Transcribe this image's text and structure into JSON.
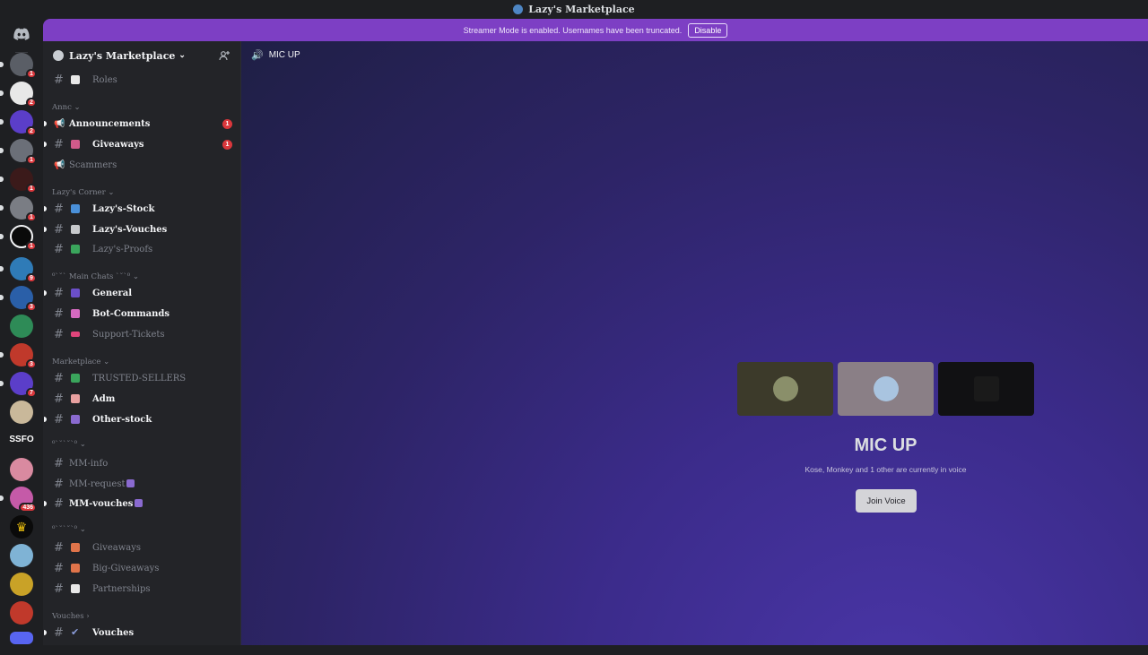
{
  "window": {
    "title": "Lazy's Marketplace"
  },
  "banner": {
    "text": "Streamer Mode is enabled. Usernames have been truncated.",
    "disable_label": "Disable"
  },
  "rail": {
    "badges": [
      "1",
      "2",
      "2",
      "1",
      "1",
      "1",
      "1",
      "9",
      "3",
      "3",
      "7",
      "436"
    ],
    "text_server_label": "SSFO"
  },
  "guild": {
    "name": "Lazy's Marketplace"
  },
  "channels": {
    "roles": "Roles",
    "cat_annc": "Annc",
    "announcements": "Announcements",
    "announcements_badge": "1",
    "giveaways1": "Giveaways",
    "giveaways1_badge": "1",
    "scammers": "Scammers",
    "cat_lazys_corner": "Lazy's Corner",
    "lazys_stock": "Lazy's-Stock",
    "lazys_vouches": "Lazy's-Vouches",
    "lazys_proofs": "Lazy's-Proofs",
    "cat_main_chats": "Main Chats",
    "general": "General",
    "bot_commands": "Bot-Commands",
    "support_tickets": "Support-Tickets",
    "cat_marketplace": "Marketplace",
    "trusted_sellers": "TRUSTED-SELLERS",
    "adm": "Adm",
    "other_stock": "Other-stock",
    "mm_info": "MM-info",
    "mm_request": "MM-request",
    "mm_vouches": "MM-vouches",
    "giveaways2": "Giveaways",
    "big_giveaways": "Big-Giveaways",
    "partnerships": "Partnerships",
    "cat_vouches": "Vouches",
    "vouches": "Vouches"
  },
  "main": {
    "channel_name": "MIC UP",
    "voice_title": "MIC UP",
    "voice_subtitle": "Kose, Monkey and 1 other are currently in voice",
    "join_label": "Join Voice"
  },
  "colors": {
    "accent_banner": "#7d3fc4",
    "badge_red": "#da373c"
  }
}
